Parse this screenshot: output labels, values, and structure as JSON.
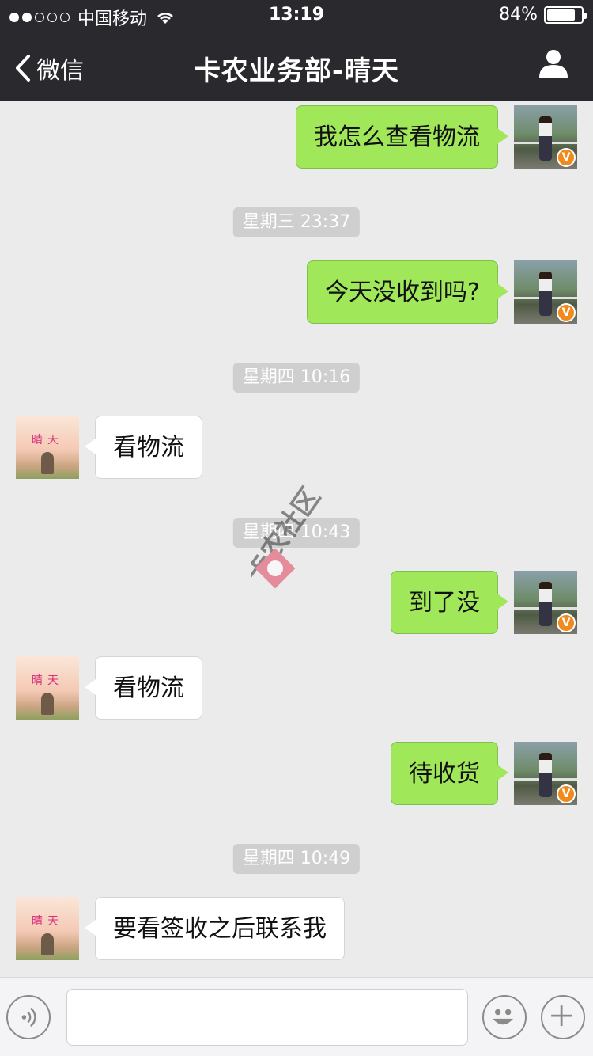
{
  "status_bar": {
    "carrier": "中国移动",
    "time": "13:19",
    "battery": "84%",
    "battery_level": 0.84,
    "signal_bars_filled": 2,
    "signal_bars_total": 5
  },
  "nav": {
    "back_label": "微信",
    "title": "卡农业务部-晴天"
  },
  "messages": [
    {
      "from": "me",
      "text": "我怎么查看物流"
    },
    {
      "type": "timestamp",
      "text": "星期三 23:37"
    },
    {
      "from": "me",
      "text": "今天没收到吗?"
    },
    {
      "type": "timestamp",
      "text": "星期四 10:16"
    },
    {
      "from": "her",
      "text": "看物流"
    },
    {
      "type": "timestamp",
      "text": "星期四 10:43"
    },
    {
      "from": "me",
      "text": "到了没"
    },
    {
      "from": "her",
      "text": "看物流"
    },
    {
      "from": "me",
      "text": "待收货"
    },
    {
      "type": "timestamp",
      "text": "星期四 10:49"
    },
    {
      "from": "her",
      "text": "要看签收之后联系我"
    }
  ],
  "avatar_her_text": "晴天",
  "avatar_badge": "V",
  "watermark_text": "卡农社区",
  "colors": {
    "nav_bg": "#2a2a2e",
    "chat_bg": "#ebebeb",
    "bubble_out": "#a0e75a",
    "bubble_in": "#ffffff",
    "timestamp_bg": "#cfcfcf",
    "badge": "#f08a1c"
  },
  "icons": {
    "back": "chevron-left-icon",
    "profile": "person-icon",
    "voice": "voice-icon",
    "emoji": "emoji-icon",
    "plus": "plus-icon",
    "wifi": "wifi-icon"
  }
}
